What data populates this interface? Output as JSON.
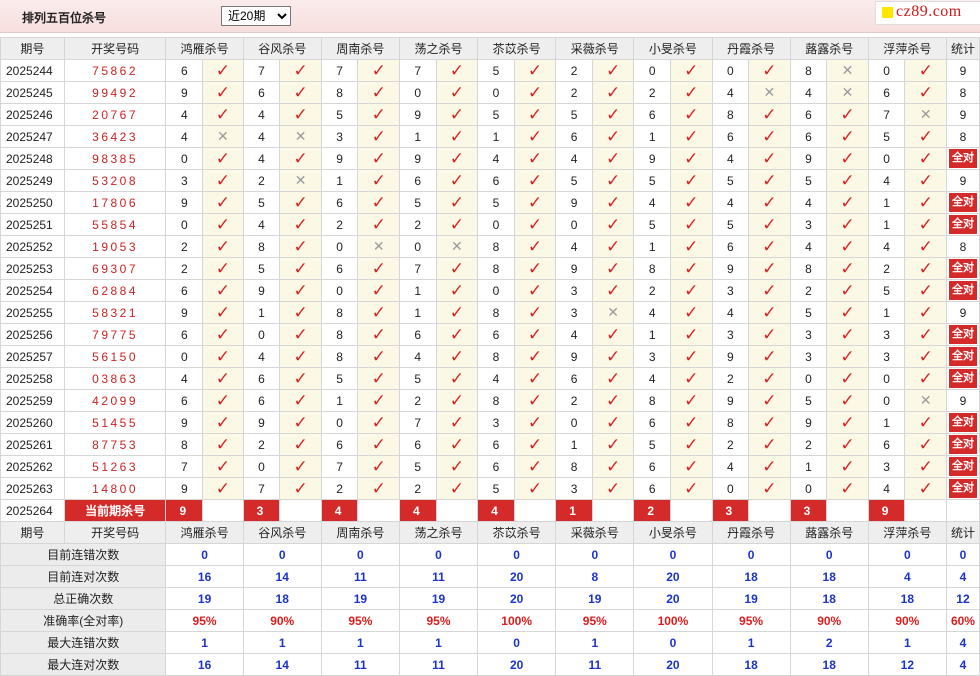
{
  "header": {
    "title": "排列五百位杀号",
    "select_value": "近20期",
    "logo": "cz89.com"
  },
  "columns": {
    "period": "期号",
    "draw": "开奖号码",
    "experts": [
      "鸿雁杀号",
      "谷风杀号",
      "周南杀号",
      "荡之杀号",
      "苶苡杀号",
      "采薇杀号",
      "小旻杀号",
      "丹霞杀号",
      "蕗露杀号",
      "浮萍杀号"
    ],
    "stat": "统计"
  },
  "allright_label": "全对",
  "rows": [
    {
      "period": "2025244",
      "draw": "75862",
      "k": [
        [
          6,
          1
        ],
        [
          7,
          1
        ],
        [
          7,
          1
        ],
        [
          7,
          1
        ],
        [
          5,
          1
        ],
        [
          2,
          1
        ],
        [
          0,
          1
        ],
        [
          0,
          1
        ],
        [
          8,
          0
        ],
        [
          0,
          1
        ]
      ],
      "stat": "9"
    },
    {
      "period": "2025245",
      "draw": "99492",
      "k": [
        [
          9,
          1
        ],
        [
          6,
          1
        ],
        [
          8,
          1
        ],
        [
          0,
          1
        ],
        [
          0,
          1
        ],
        [
          2,
          1
        ],
        [
          2,
          1
        ],
        [
          4,
          0
        ],
        [
          4,
          0
        ],
        [
          6,
          1
        ]
      ],
      "stat": "8"
    },
    {
      "period": "2025246",
      "draw": "20767",
      "k": [
        [
          4,
          1
        ],
        [
          4,
          1
        ],
        [
          5,
          1
        ],
        [
          9,
          1
        ],
        [
          5,
          1
        ],
        [
          5,
          1
        ],
        [
          6,
          1
        ],
        [
          8,
          1
        ],
        [
          6,
          1
        ],
        [
          7,
          0
        ]
      ],
      "stat": "9"
    },
    {
      "period": "2025247",
      "draw": "36423",
      "k": [
        [
          4,
          0
        ],
        [
          4,
          0
        ],
        [
          3,
          1
        ],
        [
          1,
          1
        ],
        [
          1,
          1
        ],
        [
          6,
          1
        ],
        [
          1,
          1
        ],
        [
          6,
          1
        ],
        [
          6,
          1
        ],
        [
          5,
          1
        ]
      ],
      "stat": "8"
    },
    {
      "period": "2025248",
      "draw": "98385",
      "k": [
        [
          0,
          1
        ],
        [
          4,
          1
        ],
        [
          9,
          1
        ],
        [
          9,
          1
        ],
        [
          4,
          1
        ],
        [
          4,
          1
        ],
        [
          9,
          1
        ],
        [
          4,
          1
        ],
        [
          9,
          1
        ],
        [
          0,
          1
        ]
      ],
      "stat": "全对"
    },
    {
      "period": "2025249",
      "draw": "53208",
      "k": [
        [
          3,
          1
        ],
        [
          2,
          0
        ],
        [
          1,
          1
        ],
        [
          6,
          1
        ],
        [
          6,
          1
        ],
        [
          5,
          1
        ],
        [
          5,
          1
        ],
        [
          5,
          1
        ],
        [
          5,
          1
        ],
        [
          4,
          1
        ]
      ],
      "stat": "9"
    },
    {
      "period": "2025250",
      "draw": "17806",
      "k": [
        [
          9,
          1
        ],
        [
          5,
          1
        ],
        [
          6,
          1
        ],
        [
          5,
          1
        ],
        [
          5,
          1
        ],
        [
          9,
          1
        ],
        [
          4,
          1
        ],
        [
          4,
          1
        ],
        [
          4,
          1
        ],
        [
          1,
          1
        ]
      ],
      "stat": "全对"
    },
    {
      "period": "2025251",
      "draw": "55854",
      "k": [
        [
          0,
          1
        ],
        [
          4,
          1
        ],
        [
          2,
          1
        ],
        [
          2,
          1
        ],
        [
          0,
          1
        ],
        [
          0,
          1
        ],
        [
          5,
          1
        ],
        [
          5,
          1
        ],
        [
          3,
          1
        ],
        [
          1,
          1
        ]
      ],
      "stat": "全对"
    },
    {
      "period": "2025252",
      "draw": "19053",
      "k": [
        [
          2,
          1
        ],
        [
          8,
          1
        ],
        [
          0,
          0
        ],
        [
          0,
          0
        ],
        [
          8,
          1
        ],
        [
          4,
          1
        ],
        [
          1,
          1
        ],
        [
          6,
          1
        ],
        [
          4,
          1
        ],
        [
          4,
          1
        ]
      ],
      "stat": "8"
    },
    {
      "period": "2025253",
      "draw": "69307",
      "k": [
        [
          2,
          1
        ],
        [
          5,
          1
        ],
        [
          6,
          1
        ],
        [
          7,
          1
        ],
        [
          8,
          1
        ],
        [
          9,
          1
        ],
        [
          8,
          1
        ],
        [
          9,
          1
        ],
        [
          8,
          1
        ],
        [
          2,
          1
        ]
      ],
      "stat": "全对"
    },
    {
      "period": "2025254",
      "draw": "62884",
      "k": [
        [
          6,
          1
        ],
        [
          9,
          1
        ],
        [
          0,
          1
        ],
        [
          1,
          1
        ],
        [
          0,
          1
        ],
        [
          3,
          1
        ],
        [
          2,
          1
        ],
        [
          3,
          1
        ],
        [
          2,
          1
        ],
        [
          5,
          1
        ]
      ],
      "stat": "全对"
    },
    {
      "period": "2025255",
      "draw": "58321",
      "k": [
        [
          9,
          1
        ],
        [
          1,
          1
        ],
        [
          8,
          1
        ],
        [
          1,
          1
        ],
        [
          8,
          1
        ],
        [
          3,
          0
        ],
        [
          4,
          1
        ],
        [
          4,
          1
        ],
        [
          5,
          1
        ],
        [
          1,
          1
        ]
      ],
      "stat": "9"
    },
    {
      "period": "2025256",
      "draw": "79775",
      "k": [
        [
          6,
          1
        ],
        [
          0,
          1
        ],
        [
          8,
          1
        ],
        [
          6,
          1
        ],
        [
          6,
          1
        ],
        [
          4,
          1
        ],
        [
          1,
          1
        ],
        [
          3,
          1
        ],
        [
          3,
          1
        ],
        [
          3,
          1
        ]
      ],
      "stat": "全对"
    },
    {
      "period": "2025257",
      "draw": "56150",
      "k": [
        [
          0,
          1
        ],
        [
          4,
          1
        ],
        [
          8,
          1
        ],
        [
          4,
          1
        ],
        [
          8,
          1
        ],
        [
          9,
          1
        ],
        [
          3,
          1
        ],
        [
          9,
          1
        ],
        [
          3,
          1
        ],
        [
          3,
          1
        ]
      ],
      "stat": "全对"
    },
    {
      "period": "2025258",
      "draw": "03863",
      "k": [
        [
          4,
          1
        ],
        [
          6,
          1
        ],
        [
          5,
          1
        ],
        [
          5,
          1
        ],
        [
          4,
          1
        ],
        [
          6,
          1
        ],
        [
          4,
          1
        ],
        [
          2,
          1
        ],
        [
          0,
          1
        ],
        [
          0,
          1
        ]
      ],
      "stat": "全对"
    },
    {
      "period": "2025259",
      "draw": "42099",
      "k": [
        [
          6,
          1
        ],
        [
          6,
          1
        ],
        [
          1,
          1
        ],
        [
          2,
          1
        ],
        [
          8,
          1
        ],
        [
          2,
          1
        ],
        [
          8,
          1
        ],
        [
          9,
          1
        ],
        [
          5,
          1
        ],
        [
          0,
          0
        ]
      ],
      "stat": "9"
    },
    {
      "period": "2025260",
      "draw": "51455",
      "k": [
        [
          9,
          1
        ],
        [
          9,
          1
        ],
        [
          0,
          1
        ],
        [
          7,
          1
        ],
        [
          3,
          1
        ],
        [
          0,
          1
        ],
        [
          6,
          1
        ],
        [
          8,
          1
        ],
        [
          9,
          1
        ],
        [
          1,
          1
        ]
      ],
      "stat": "全对"
    },
    {
      "period": "2025261",
      "draw": "87753",
      "k": [
        [
          8,
          1
        ],
        [
          2,
          1
        ],
        [
          6,
          1
        ],
        [
          6,
          1
        ],
        [
          6,
          1
        ],
        [
          1,
          1
        ],
        [
          5,
          1
        ],
        [
          2,
          1
        ],
        [
          2,
          1
        ],
        [
          6,
          1
        ]
      ],
      "stat": "全对"
    },
    {
      "period": "2025262",
      "draw": "51263",
      "k": [
        [
          7,
          1
        ],
        [
          0,
          1
        ],
        [
          7,
          1
        ],
        [
          5,
          1
        ],
        [
          6,
          1
        ],
        [
          8,
          1
        ],
        [
          6,
          1
        ],
        [
          4,
          1
        ],
        [
          1,
          1
        ],
        [
          3,
          1
        ]
      ],
      "stat": "全对"
    },
    {
      "period": "2025263",
      "draw": "14800",
      "k": [
        [
          9,
          1
        ],
        [
          7,
          1
        ],
        [
          2,
          1
        ],
        [
          2,
          1
        ],
        [
          5,
          1
        ],
        [
          3,
          1
        ],
        [
          6,
          1
        ],
        [
          0,
          1
        ],
        [
          0,
          1
        ],
        [
          4,
          1
        ]
      ],
      "stat": "全对"
    }
  ],
  "current": {
    "period": "2025264",
    "label": "当前期杀号",
    "kills": [
      "9",
      "3",
      "4",
      "4",
      "4",
      "1",
      "2",
      "3",
      "3",
      "9"
    ]
  },
  "summary": [
    {
      "label": "目前连错次数",
      "vals": [
        "0",
        "0",
        "0",
        "0",
        "0",
        "0",
        "0",
        "0",
        "0",
        "0"
      ],
      "stat": "0",
      "rate": false
    },
    {
      "label": "目前连对次数",
      "vals": [
        "16",
        "14",
        "11",
        "11",
        "20",
        "8",
        "20",
        "18",
        "18",
        "4"
      ],
      "stat": "4",
      "rate": false
    },
    {
      "label": "总正确次数",
      "vals": [
        "19",
        "18",
        "19",
        "19",
        "20",
        "19",
        "20",
        "19",
        "18",
        "18"
      ],
      "stat": "12",
      "rate": false
    },
    {
      "label": "准确率(全对率)",
      "vals": [
        "95%",
        "90%",
        "95%",
        "95%",
        "100%",
        "95%",
        "100%",
        "95%",
        "90%",
        "90%"
      ],
      "stat": "60%",
      "rate": true
    },
    {
      "label": "最大连错次数",
      "vals": [
        "1",
        "1",
        "1",
        "1",
        "0",
        "1",
        "0",
        "1",
        "2",
        "1"
      ],
      "stat": "4",
      "rate": false
    },
    {
      "label": "最大连对次数",
      "vals": [
        "16",
        "14",
        "11",
        "11",
        "20",
        "11",
        "20",
        "18",
        "18",
        "12"
      ],
      "stat": "4",
      "rate": false
    }
  ],
  "colors": {
    "accent_red": "#d42a2a",
    "check_red": "#e02020",
    "stat_blue": "#1a33cc",
    "mark_bg": "#fbf9e6"
  },
  "icons": {
    "hit": "check-icon",
    "miss": "cross-icon",
    "logo_mark": "yellow-square-icon"
  }
}
